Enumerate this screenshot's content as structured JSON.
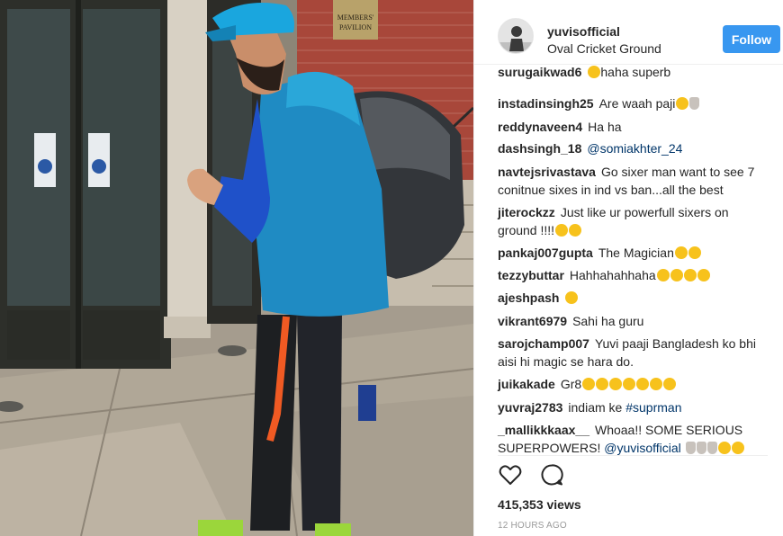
{
  "post": {
    "username": "yuvisofficial",
    "location": "Oval Cricket Ground",
    "follow_label": "Follow",
    "views": "415,353 views",
    "time": "12 HOURS AGO",
    "photo_sign": [
      "MEMBERS'",
      "PAVILION"
    ]
  },
  "comments": [
    {
      "user": "surugaikwad6",
      "text": "haha superb",
      "emoji_before": 1
    },
    {
      "user": "instadinsingh25",
      "text": "Are waah paji",
      "emoji_after": "face+hand"
    },
    {
      "user": "reddynaveen4",
      "text": "Ha ha"
    },
    {
      "user": "dashsingh_18",
      "mention": "@somiakhter_24"
    },
    {
      "user": "navtejsrivastava",
      "text": "Go sixer man want to see 7 conitnue sixes in ind vs ban...all the best"
    },
    {
      "user": "jiterockzz",
      "text": "Just like ur powerfull sixers on ground !!!!",
      "emoji_count": 2
    },
    {
      "user": "pankaj007gupta",
      "text": "The Magician",
      "emoji_count": 2
    },
    {
      "user": "tezzybuttar",
      "text": "Hahhahahhaha",
      "emoji_count": 4
    },
    {
      "user": "ajeshpash",
      "text": "",
      "emoji_count": 1
    },
    {
      "user": "vikrant6979",
      "text": "Sahi ha guru"
    },
    {
      "user": "sarojchamp007",
      "text": "Yuvi paaji Bangladesh ko bhi aisi hi magic se hara do."
    },
    {
      "user": "juikakade",
      "text": "Gr8",
      "emoji_count": 7
    },
    {
      "user": "yuvraj2783",
      "text": "indiam ke",
      "mention": "#suprman"
    },
    {
      "user": "_mallikkkaax__",
      "text": "Whoaa!! SOME SERIOUS SUPERPOWERS!",
      "mention": "@yuvisofficial",
      "emoji_after": "hands3+face2"
    }
  ],
  "icons": {
    "like": "heart-outline-icon",
    "comment": "speech-bubble-icon"
  },
  "colors": {
    "follow_bg": "#3897f0",
    "mention": "#003569",
    "border": "#efefef"
  }
}
